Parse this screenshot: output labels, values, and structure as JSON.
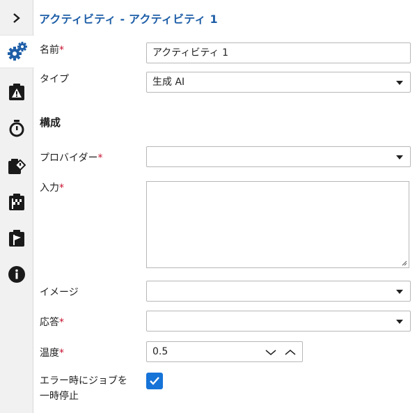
{
  "header": {
    "title": "アクティビティ  - アクティビティ 1"
  },
  "sidebar": {
    "items": [
      {
        "icon": "chevron-right-icon"
      },
      {
        "icon": "gears-icon"
      },
      {
        "icon": "warning-clipboard-icon"
      },
      {
        "icon": "stopwatch-icon"
      },
      {
        "icon": "clipboard-diamond-icon"
      },
      {
        "icon": "checkered-flag-clipboard-icon"
      },
      {
        "icon": "flag-clipboard-icon"
      },
      {
        "icon": "info-icon"
      }
    ]
  },
  "form": {
    "name_label": "名前",
    "name_value": "アクティビティ 1",
    "type_label": "タイプ",
    "type_value": "生成 AI",
    "section_title": "構成",
    "provider_label": "プロバイダー",
    "provider_value": "",
    "input_label": "入力",
    "input_value": "",
    "image_label": "イメージ",
    "image_value": "",
    "response_label": "応答",
    "response_value": "",
    "temperature_label": "温度",
    "temperature_value": "0.5",
    "pause_on_error_label_line1": "エラー時にジョブを",
    "pause_on_error_label_line2": "一時停止",
    "pause_on_error_checked": true,
    "required_mark": "*"
  },
  "colors": {
    "accent": "#1f5fa8",
    "checkbox": "#1673d8",
    "required": "#c8102e",
    "icon": "#1a1a1a"
  }
}
